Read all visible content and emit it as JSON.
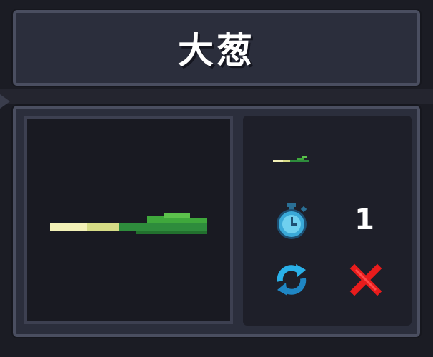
{
  "item": {
    "name": "大葱",
    "count": "1"
  },
  "icons": {
    "item_icon": "scallion-icon",
    "timer_icon": "stopwatch-icon",
    "refresh_icon": "refresh-icon",
    "close_icon": "close-icon"
  },
  "colors": {
    "panel_bg": "#2b2e3c",
    "panel_border": "#4a4e60",
    "scallion_white": "#f0f0b0",
    "scallion_green": "#2e8c3c",
    "scallion_leaf": "#4cba44",
    "timer_cyan": "#3aa9d8",
    "refresh_cyan": "#2ab0e8",
    "close_red": "#e81c1c"
  }
}
